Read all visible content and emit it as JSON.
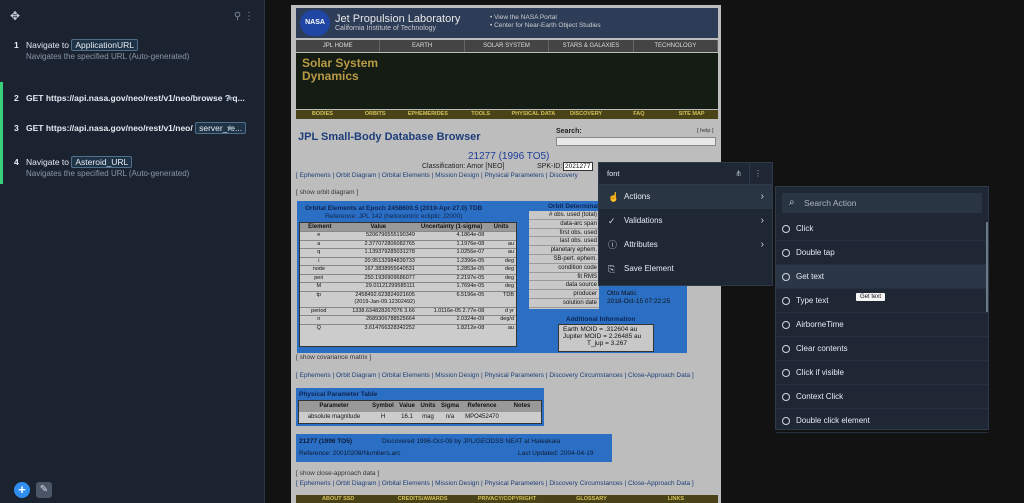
{
  "panel": {
    "steps": [
      {
        "num": "1",
        "prefix": "Navigate to",
        "chip": "ApplicationURL",
        "sub": "Navigates the specified URL (Auto-generated)"
      },
      {
        "num": "2",
        "text": "GET https://api.nasa.gov/neo/rest/v1/neo/browse ? q..."
      },
      {
        "num": "3",
        "text": "GET https://api.nasa.gov/neo/rest/v1/neo/",
        "chip": "server_re..."
      },
      {
        "num": "4",
        "prefix": "Navigate to",
        "chip": "Asteroid_URL",
        "sub": "Navigates the specified URL (Auto-generated)"
      }
    ]
  },
  "jpl": {
    "nasa": "NASA",
    "title": "Jet Propulsion Laboratory",
    "subtitle": "California Institute of Technology",
    "links": [
      "• View the NASA Portal",
      "• Center for Near-Earth Object Studies"
    ],
    "topnav": [
      "JPL HOME",
      "EARTH",
      "SOLAR SYSTEM",
      "STARS & GALAXIES",
      "TECHNOLOGY"
    ],
    "banner": [
      "Solar System",
      "Dynamics"
    ],
    "bnav": [
      "BODIES",
      "ORBITS",
      "EPHEMERIDES",
      "TOOLS",
      "PHYSICAL DATA",
      "DISCOVERY",
      "FAQ",
      "SITE MAP"
    ],
    "sbdb": "JPL Small-Body Database Browser",
    "search": "Search:",
    "help": "[ help ]",
    "object": "21277 (1996 TO5)",
    "classification": "Classification: Amor [NEO]",
    "spk_label": "SPK-ID:",
    "spk": "2021277",
    "links1": "[ Ephemeris | Orbit Diagram | Orbital Elements | Mission Design | Physical Parameters | Discovery",
    "show_orbit": "[ show orbit diagram ]",
    "orbit_title": "Orbital Elements at Epoch 2458600.5 (2019-Apr-27.0) TDB",
    "orbit_ref": "Reference: JPL 142 (heliocentric ecliptic J2000)",
    "orbit_cols": [
      "Element",
      "Value",
      "Uncertainty (1-sigma)",
      "Units"
    ],
    "orbit_rows": [
      [
        "e",
        "5206796555190349",
        "4.1864e-08",
        ""
      ],
      [
        "a",
        "2.377072806082765",
        "1.1976e-08",
        "au"
      ],
      [
        "q",
        "1.139379285031278",
        "1.0256e-07",
        "au"
      ],
      [
        "i",
        "20.95132984839733",
        "1.2396e-05",
        "deg"
      ],
      [
        "node",
        "167.3838955640531",
        "1.2853e-05",
        "deg"
      ],
      [
        "peri",
        "250.1936909686077",
        "2.2197e-05",
        "deg"
      ],
      [
        "M",
        "29.01121299585111",
        "1.7694e-05",
        "deg"
      ],
      [
        "tp",
        "2458492.623824921605 (2019-Jan-09.12302492)",
        "6.5196e-05",
        "TDB"
      ],
      [
        "period",
        "1338.634828267076 3.66",
        "1.0116e-05 2.77e-08",
        "d yr"
      ],
      [
        "n",
        "2689306788525664",
        "2.0324e-09",
        "deg/d"
      ],
      [
        "Q",
        "3.614766328342252",
        "1.8212e-08",
        "au"
      ]
    ],
    "det_title": "Orbit Determinat",
    "det_rows": [
      "# obs. used (total)",
      "data-arc span",
      "first obs. used",
      "last obs. used",
      "planetary ephem.",
      "SB-pert. ephem.",
      "condition code",
      "fit RMS",
      "data source",
      "producer",
      "solution date"
    ],
    "producer": "Otto Matic",
    "solution_date": "2018-Oct-15 07:22:25",
    "addl_title": "Additional Information",
    "moid": [
      "Earth MOID = .312604 au",
      "Jupiter MOID = 2.26485 au",
      "T_jup = 3.267"
    ],
    "show_cov": "[ show covariance matrix ]",
    "links2": "[ Ephemeris | Orbit Diagram | Orbital Elements | Mission Design | Physical Parameters | Discovery Circumstances | Close-Approach Data ]",
    "phys_title": "Physical Parameter Table",
    "phys_cols": [
      "Parameter",
      "Symbol",
      "Value",
      "Units",
      "Sigma",
      "Reference",
      "Notes"
    ],
    "phys_row": [
      "absolute magnitude",
      "H",
      "16.1",
      "mag",
      "n/a",
      "MPO452470",
      ""
    ],
    "disc_obj": "21277 (1996 TO5)",
    "disc_text": "Discovered 1996-Oct-09 by JPL/GEODSS NEAT at Haleakala",
    "disc_ref": "Reference: 20010208/Numbers.arc",
    "disc_upd": "Last Updated: 2004-04-19",
    "show_close": "[ show close-approach data ]",
    "links3": "[ Ephemeris | Orbit Diagram | Orbital Elements | Mission Design | Physical Parameters | Discovery Circumstances | Close-Approach Data ]",
    "footnav": [
      "ABOUT SSD",
      "CREDITS/AWARDS",
      "PRIVACY/COPYRIGHT",
      "GLOSSARY",
      "LINKS"
    ]
  },
  "ctx": {
    "title": "font",
    "items": [
      "Actions",
      "Validations",
      "Attributes",
      "Save Element"
    ]
  },
  "actions": {
    "search_placeholder": "Search Action",
    "items": [
      "Click",
      "Double tap",
      "Get text",
      "Type text",
      "AirborneTime",
      "Clear contents",
      "Click if visible",
      "Context Click",
      "Double click element"
    ],
    "tooltip": "Get text"
  },
  "colors": {
    "accent": "#3ad07a",
    "fab": "#2f8ef0",
    "panel": "#1b2330"
  }
}
